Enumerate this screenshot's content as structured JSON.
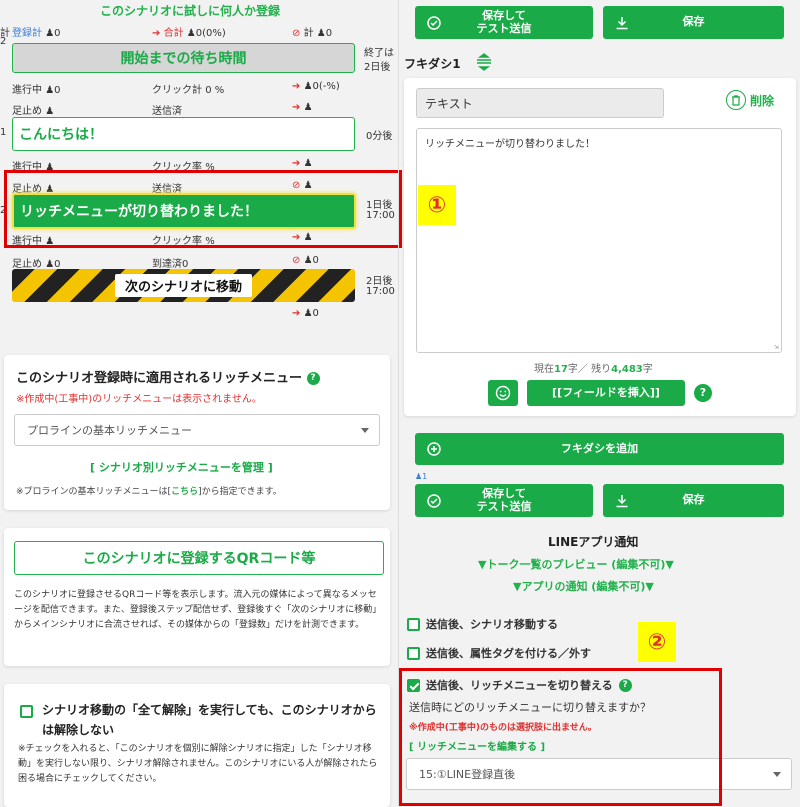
{
  "scenario": {
    "header": "このシナリオに試しに何人か登録",
    "row0": {
      "left_a": "計",
      "left_b": "2",
      "register": "登録計",
      "register_v": "0",
      "total": "合計",
      "total_v": "0(0%)",
      "stop_total": "計",
      "stop_total_v": "0"
    },
    "wait": {
      "label": "開始までの待ち時間",
      "end_a": "終了は",
      "end_b": "2日後"
    },
    "row1": {
      "progress": "進行中",
      "progress_v": "0",
      "click": "クリック計",
      "click_v": "0 %",
      "out_v": "0(-%)"
    },
    "row2": {
      "stop": "足止め",
      "sent": "送信済"
    },
    "msg1": {
      "num": "1",
      "text": "こんにちは！",
      "timing": "0分後"
    },
    "row3": {
      "progress": "進行中",
      "click": "クリック率",
      "click_v": "%"
    },
    "row4": {
      "stop": "足止め",
      "sent": "送信済"
    },
    "msg2": {
      "num": "2",
      "text": "リッチメニューが切り替わりました！",
      "timing_a": "1日後",
      "timing_b": "17:00"
    },
    "row5": {
      "progress": "進行中",
      "click": "クリック率",
      "click_v": "%"
    },
    "row6": {
      "stop": "足止め",
      "stop_v": "0",
      "reached": "到達済",
      "reached_v": "0",
      "ban_v": "0"
    },
    "move": {
      "label": "次のシナリオに移動",
      "timing_a": "2日後",
      "timing_b": "17:00",
      "out_v": "0"
    }
  },
  "richmenu_card": {
    "title": "このシナリオ登録時に適用されるリッチメニュー",
    "warning": "※作成中(工事中)のリッチメニューは表示されません。",
    "select_value": "プロラインの基本リッチメニュー",
    "manage_link": "シナリオ別リッチメニューを管理",
    "note_a": "※プロラインの基本リッチメニューは[",
    "note_link": "こちら",
    "note_b": "]から指定できます。"
  },
  "qr_card": {
    "button": "このシナリオに登録するQRコード等",
    "desc": "このシナリオに登録させるQRコード等を表示します。流入元の媒体によって異なるメッセージを配信できます。また、登録後ステップ配信せず、登録後すぐ「次のシナリオに移動」からメインシナリオに合流させれば、その媒体からの「登録数」だけを計測できます。"
  },
  "release_card": {
    "title": "シナリオ移動の「全て解除」を実行しても、このシナリオからは解除しない",
    "desc": "※チェックを入れると、「このシナリオを個別に解除シナリオに指定」した「シナリオ移動」を実行しない限り、シナリオ解除されません。このシナリオにいる人が解除されたら困る場合にチェックしてください。"
  },
  "editor": {
    "save_test": "保存して\nテスト送信",
    "save": "保存",
    "bubble_title": "フキダシ1",
    "type_value": "テキスト",
    "delete": "削除",
    "message": "リッチメニューが切り替わりました！",
    "count_a": "現在",
    "count_current": "17",
    "count_b": "字／ 残り",
    "count_left": "4,483",
    "count_c": "字",
    "insert_field": "[[フィールドを挿入]]",
    "add_bubble": "フキダシを追加",
    "user_count": "1",
    "save_test2": "保存して\nテスト送信",
    "save2": "保存"
  },
  "line_notify": {
    "title": "LINEアプリ通知",
    "preview_talk": "▼トーク一覧のプレビュー (編集不可)▼",
    "preview_app": "▼アプリの通知 (編集不可)▼"
  },
  "after_send": {
    "move": "送信後、シナリオ移動する",
    "tag": "送信後、属性タグを付ける／外す",
    "richmenu": "送信後、リッチメニューを切り替える",
    "question": "送信時にどのリッチメニューに切り替えますか？",
    "warning": "※作成中(工事中)のものは選択肢に出ません。",
    "edit_link": "リッチメニューを編集する",
    "select_value": "15:①LINE登録直後"
  },
  "markers": {
    "one": "①",
    "two": "②"
  },
  "colors": {
    "green": "#1aaa47",
    "red": "#e00000",
    "yellow": "#ffff00"
  }
}
